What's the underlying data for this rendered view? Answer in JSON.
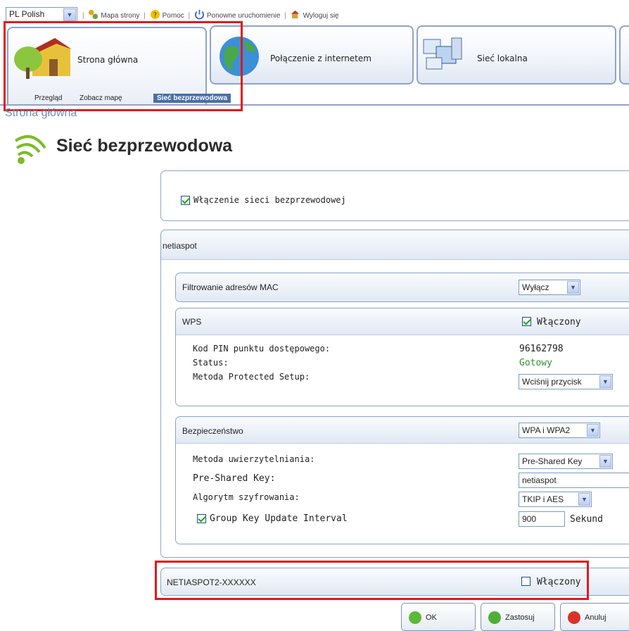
{
  "top_bar": {
    "language": "PL Polish",
    "links": {
      "site_map": "Mapa strony",
      "help": "Pomoc",
      "restart": "Ponowne uruchomienie",
      "logout": "Wyloguj się"
    }
  },
  "tabs": {
    "home": "Strona główna",
    "internet": "Połączenie z internetem",
    "lan": "Sieć lokalna"
  },
  "subnav": {
    "overview": "Przegląd",
    "map": "Zobacz mapę",
    "wireless": "Sieć bezprzewodowa"
  },
  "breadcrumb": "Strona główna",
  "page_title": "Sieć bezprzewodowa",
  "enable_wireless": {
    "label": "Włączenie sieci bezprzewodowej",
    "checked": true
  },
  "network1": {
    "name": "netiaspot",
    "mac_filter": {
      "label": "Filtrowanie adresów MAC",
      "value": "Wyłącz"
    },
    "wps": {
      "title": "WPS",
      "enabled_label": "Włączony",
      "enabled": true,
      "pin_label": "Kod PIN punktu dostępowego:",
      "pin_value": "96162798",
      "status_label": "Status:",
      "status_value": "Gotowy",
      "method_label": "Metoda Protected Setup:",
      "method_value": "Wciśnij przycisk"
    },
    "security": {
      "title": "Bezpieczeństwo",
      "mode": "WPA i WPA2",
      "auth_label": "Metoda uwierzytelniania:",
      "auth_value": "Pre-Shared Key",
      "psk_label": "Pre-Shared Key:",
      "psk_value": "netiaspot",
      "algo_label": "Algorytm szyfrowania:",
      "algo_value": "TKIP i AES",
      "group_key_label": "Group Key Update Interval",
      "group_key_checked": true,
      "group_key_value": "900",
      "group_key_unit": "Sekund"
    }
  },
  "network2": {
    "name": "NETIASPOT2-XXXXXX",
    "enabled_label": "Włączony",
    "enabled": false
  },
  "buttons": {
    "ok": "OK",
    "apply": "Zastosuj",
    "cancel": "Anuluj"
  },
  "colors": {
    "highlight": "#e01a1a",
    "status_ok": "#2f8f2f",
    "accent": "#4b6fa6"
  }
}
